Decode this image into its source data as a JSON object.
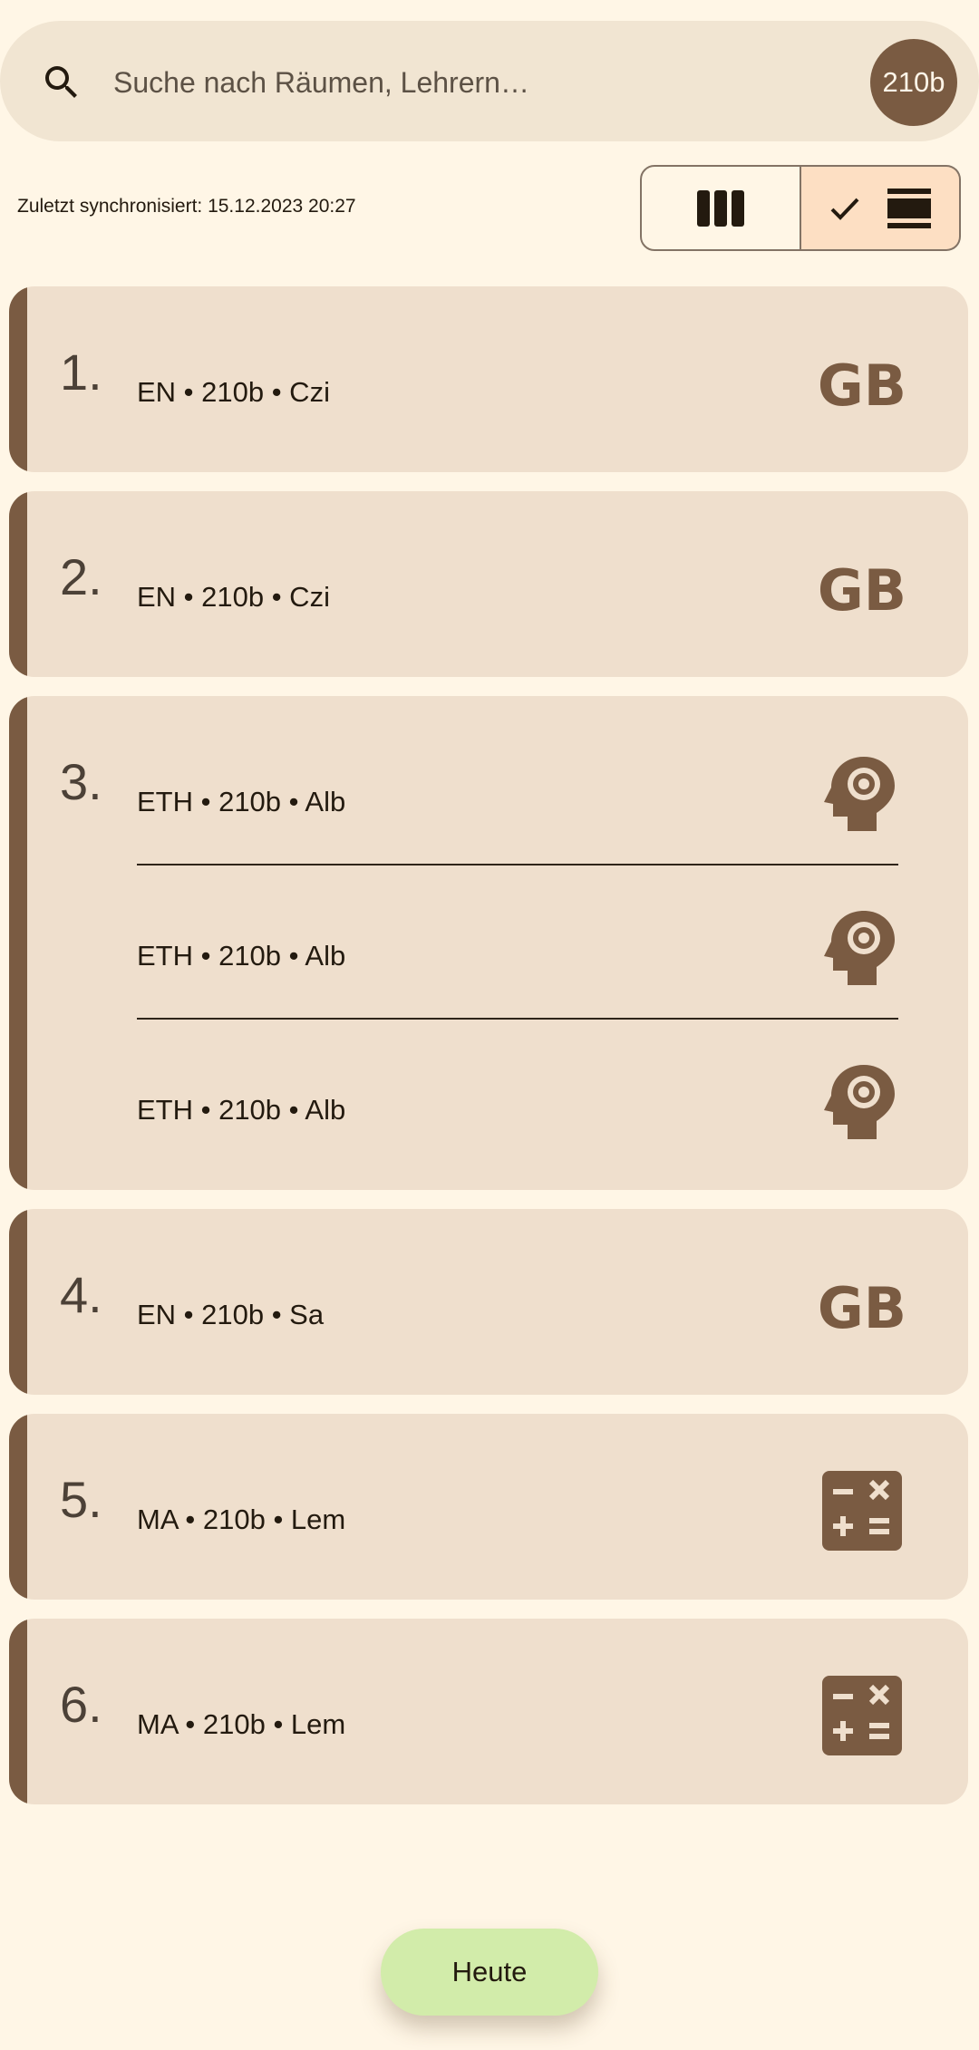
{
  "search": {
    "placeholder": "Suche nach Räumen, Lehrern…",
    "class_badge": "210b"
  },
  "sync": {
    "label": "Zuletzt synchronisiert: 15.12.2023 20:27"
  },
  "view_toggle": {
    "options": [
      "columns-view",
      "list-view"
    ],
    "selected": "list-view"
  },
  "periods": [
    {
      "number": "1.",
      "entries": [
        {
          "text": "EN • 210b • Czi",
          "icon": "gb-flag-icon"
        }
      ]
    },
    {
      "number": "2.",
      "entries": [
        {
          "text": "EN • 210b • Czi",
          "icon": "gb-flag-icon"
        }
      ]
    },
    {
      "number": "3.",
      "entries": [
        {
          "text": "ETH • 210b • Alb",
          "icon": "psychology-head-icon"
        },
        {
          "text": "ETH • 210b • Alb",
          "icon": "psychology-head-icon"
        },
        {
          "text": "ETH • 210b • Alb",
          "icon": "psychology-head-icon"
        }
      ]
    },
    {
      "number": "4.",
      "entries": [
        {
          "text": "EN • 210b • Sa",
          "icon": "gb-flag-icon"
        }
      ]
    },
    {
      "number": "5.",
      "entries": [
        {
          "text": "MA • 210b • Lem",
          "icon": "calculator-icon"
        }
      ]
    },
    {
      "number": "6.",
      "entries": [
        {
          "text": "MA • 210b • Lem",
          "icon": "calculator-icon"
        }
      ]
    }
  ],
  "fab": {
    "label": "Heute"
  },
  "colors": {
    "background": "#fff6e6",
    "card": "#efdfcd",
    "accent": "#7a5b42",
    "fab": "#d2ecaa",
    "toggle_selected": "#fddfc3"
  }
}
